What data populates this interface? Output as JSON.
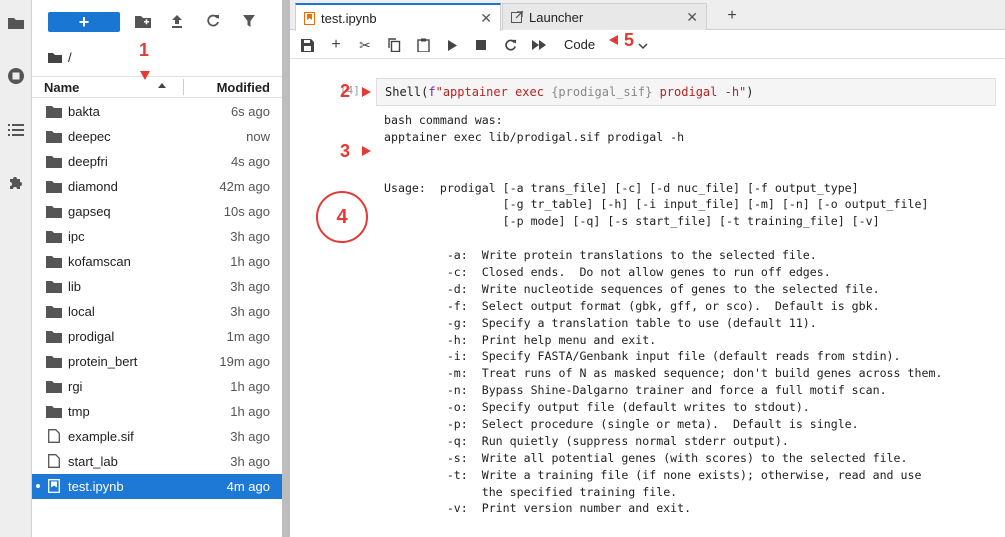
{
  "activity_bar": {
    "icons": [
      "folder-icon",
      "running-icon",
      "toc-icon",
      "extensions-icon"
    ]
  },
  "file_browser": {
    "new_label": "+",
    "breadcrumb": "/",
    "columns": {
      "name": "Name",
      "modified": "Modified"
    },
    "items": [
      {
        "name": "bakta",
        "modified": "6s ago",
        "type": "folder"
      },
      {
        "name": "deepec",
        "modified": "now",
        "type": "folder"
      },
      {
        "name": "deepfri",
        "modified": "4s ago",
        "type": "folder"
      },
      {
        "name": "diamond",
        "modified": "42m ago",
        "type": "folder"
      },
      {
        "name": "gapseq",
        "modified": "10s ago",
        "type": "folder"
      },
      {
        "name": "ipc",
        "modified": "3h ago",
        "type": "folder"
      },
      {
        "name": "kofamscan",
        "modified": "1h ago",
        "type": "folder"
      },
      {
        "name": "lib",
        "modified": "3h ago",
        "type": "folder"
      },
      {
        "name": "local",
        "modified": "3h ago",
        "type": "folder"
      },
      {
        "name": "prodigal",
        "modified": "1m ago",
        "type": "folder"
      },
      {
        "name": "protein_bert",
        "modified": "19m ago",
        "type": "folder"
      },
      {
        "name": "rgi",
        "modified": "1h ago",
        "type": "folder"
      },
      {
        "name": "tmp",
        "modified": "1h ago",
        "type": "folder"
      },
      {
        "name": "example.sif",
        "modified": "3h ago",
        "type": "file"
      },
      {
        "name": "start_lab",
        "modified": "3h ago",
        "type": "file"
      },
      {
        "name": "test.ipynb",
        "modified": "4m ago",
        "type": "notebook",
        "selected": true
      }
    ]
  },
  "tabs": [
    {
      "label": "test.ipynb",
      "active": true
    },
    {
      "label": "Launcher",
      "active": false
    }
  ],
  "notebook_toolbar": {
    "cell_type": "Code"
  },
  "cell": {
    "prompt": "[4]:",
    "code_parts": {
      "fn": "Shell(",
      "prefix": "f",
      "str1": "\"apptainer exec ",
      "var": "{prodigal_sif}",
      "str2": " prodigal -h\"",
      "close": ")"
    }
  },
  "output_lines": [
    "bash command was:",
    "apptainer exec lib/prodigal.sif prodigal -h",
    "",
    "",
    "Usage:  prodigal [-a trans_file] [-c] [-d nuc_file] [-f output_type]",
    "                 [-g tr_table] [-h] [-i input_file] [-m] [-n] [-o output_file]",
    "                 [-p mode] [-q] [-s start_file] [-t training_file] [-v]",
    "",
    "         -a:  Write protein translations to the selected file.",
    "         -c:  Closed ends.  Do not allow genes to run off edges.",
    "         -d:  Write nucleotide sequences of genes to the selected file.",
    "         -f:  Select output format (gbk, gff, or sco).  Default is gbk.",
    "         -g:  Specify a translation table to use (default 11).",
    "         -h:  Print help menu and exit.",
    "         -i:  Specify FASTA/Genbank input file (default reads from stdin).",
    "         -m:  Treat runs of N as masked sequence; don't build genes across them.",
    "         -n:  Bypass Shine-Dalgarno trainer and force a full motif scan.",
    "         -o:  Specify output file (default writes to stdout).",
    "         -p:  Select procedure (single or meta).  Default is single.",
    "         -q:  Run quietly (suppress normal stderr output).",
    "         -s:  Write all potential genes (with scores) to the selected file.",
    "         -t:  Write a training file (if none exists); otherwise, read and use",
    "              the specified training file.",
    "         -v:  Print version number and exit."
  ],
  "annotations": {
    "a1": "1",
    "a2": "2",
    "a3": "3",
    "a4": "4",
    "a5": "5"
  },
  "colors": {
    "accent": "#1976d2",
    "selection": "#1e78d6",
    "annotation": "#e53935"
  }
}
